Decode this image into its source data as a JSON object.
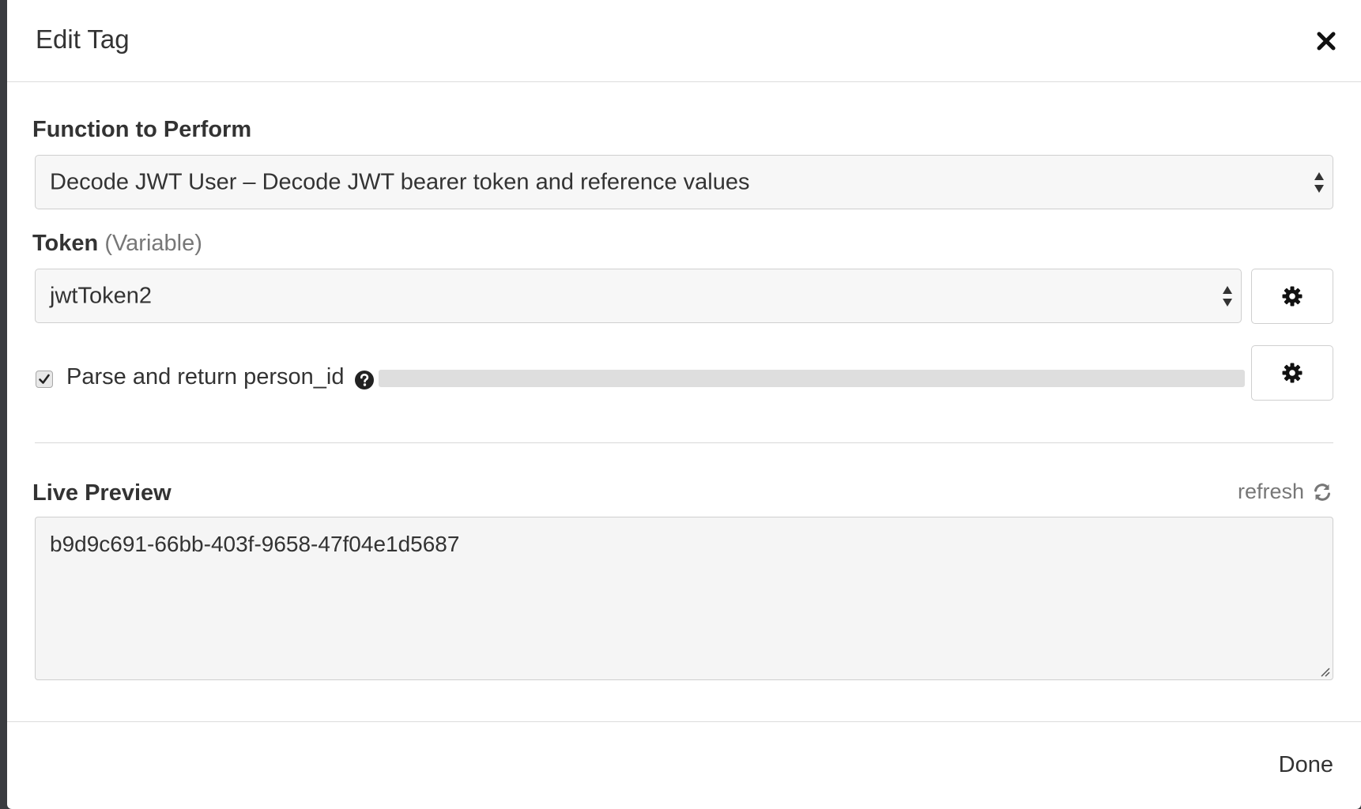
{
  "modal": {
    "title": "Edit Tag",
    "close_icon": "close-icon"
  },
  "function_field": {
    "label": "Function to Perform",
    "selected": "Decode JWT User – Decode JWT bearer token and reference values"
  },
  "token_field": {
    "label": "Token",
    "label_hint": "(Variable)",
    "selected": "jwtToken2",
    "settings_icon": "gear-icon"
  },
  "parse_option": {
    "label": "Parse and return person_id",
    "checked": true,
    "help_icon": "question-circle-icon",
    "settings_icon": "gear-icon"
  },
  "live_preview": {
    "label": "Live Preview",
    "refresh_label": "refresh",
    "refresh_icon": "refresh-icon",
    "value": "b9d9c691-66bb-403f-9658-47f04e1d5687"
  },
  "footer": {
    "done_label": "Done"
  }
}
